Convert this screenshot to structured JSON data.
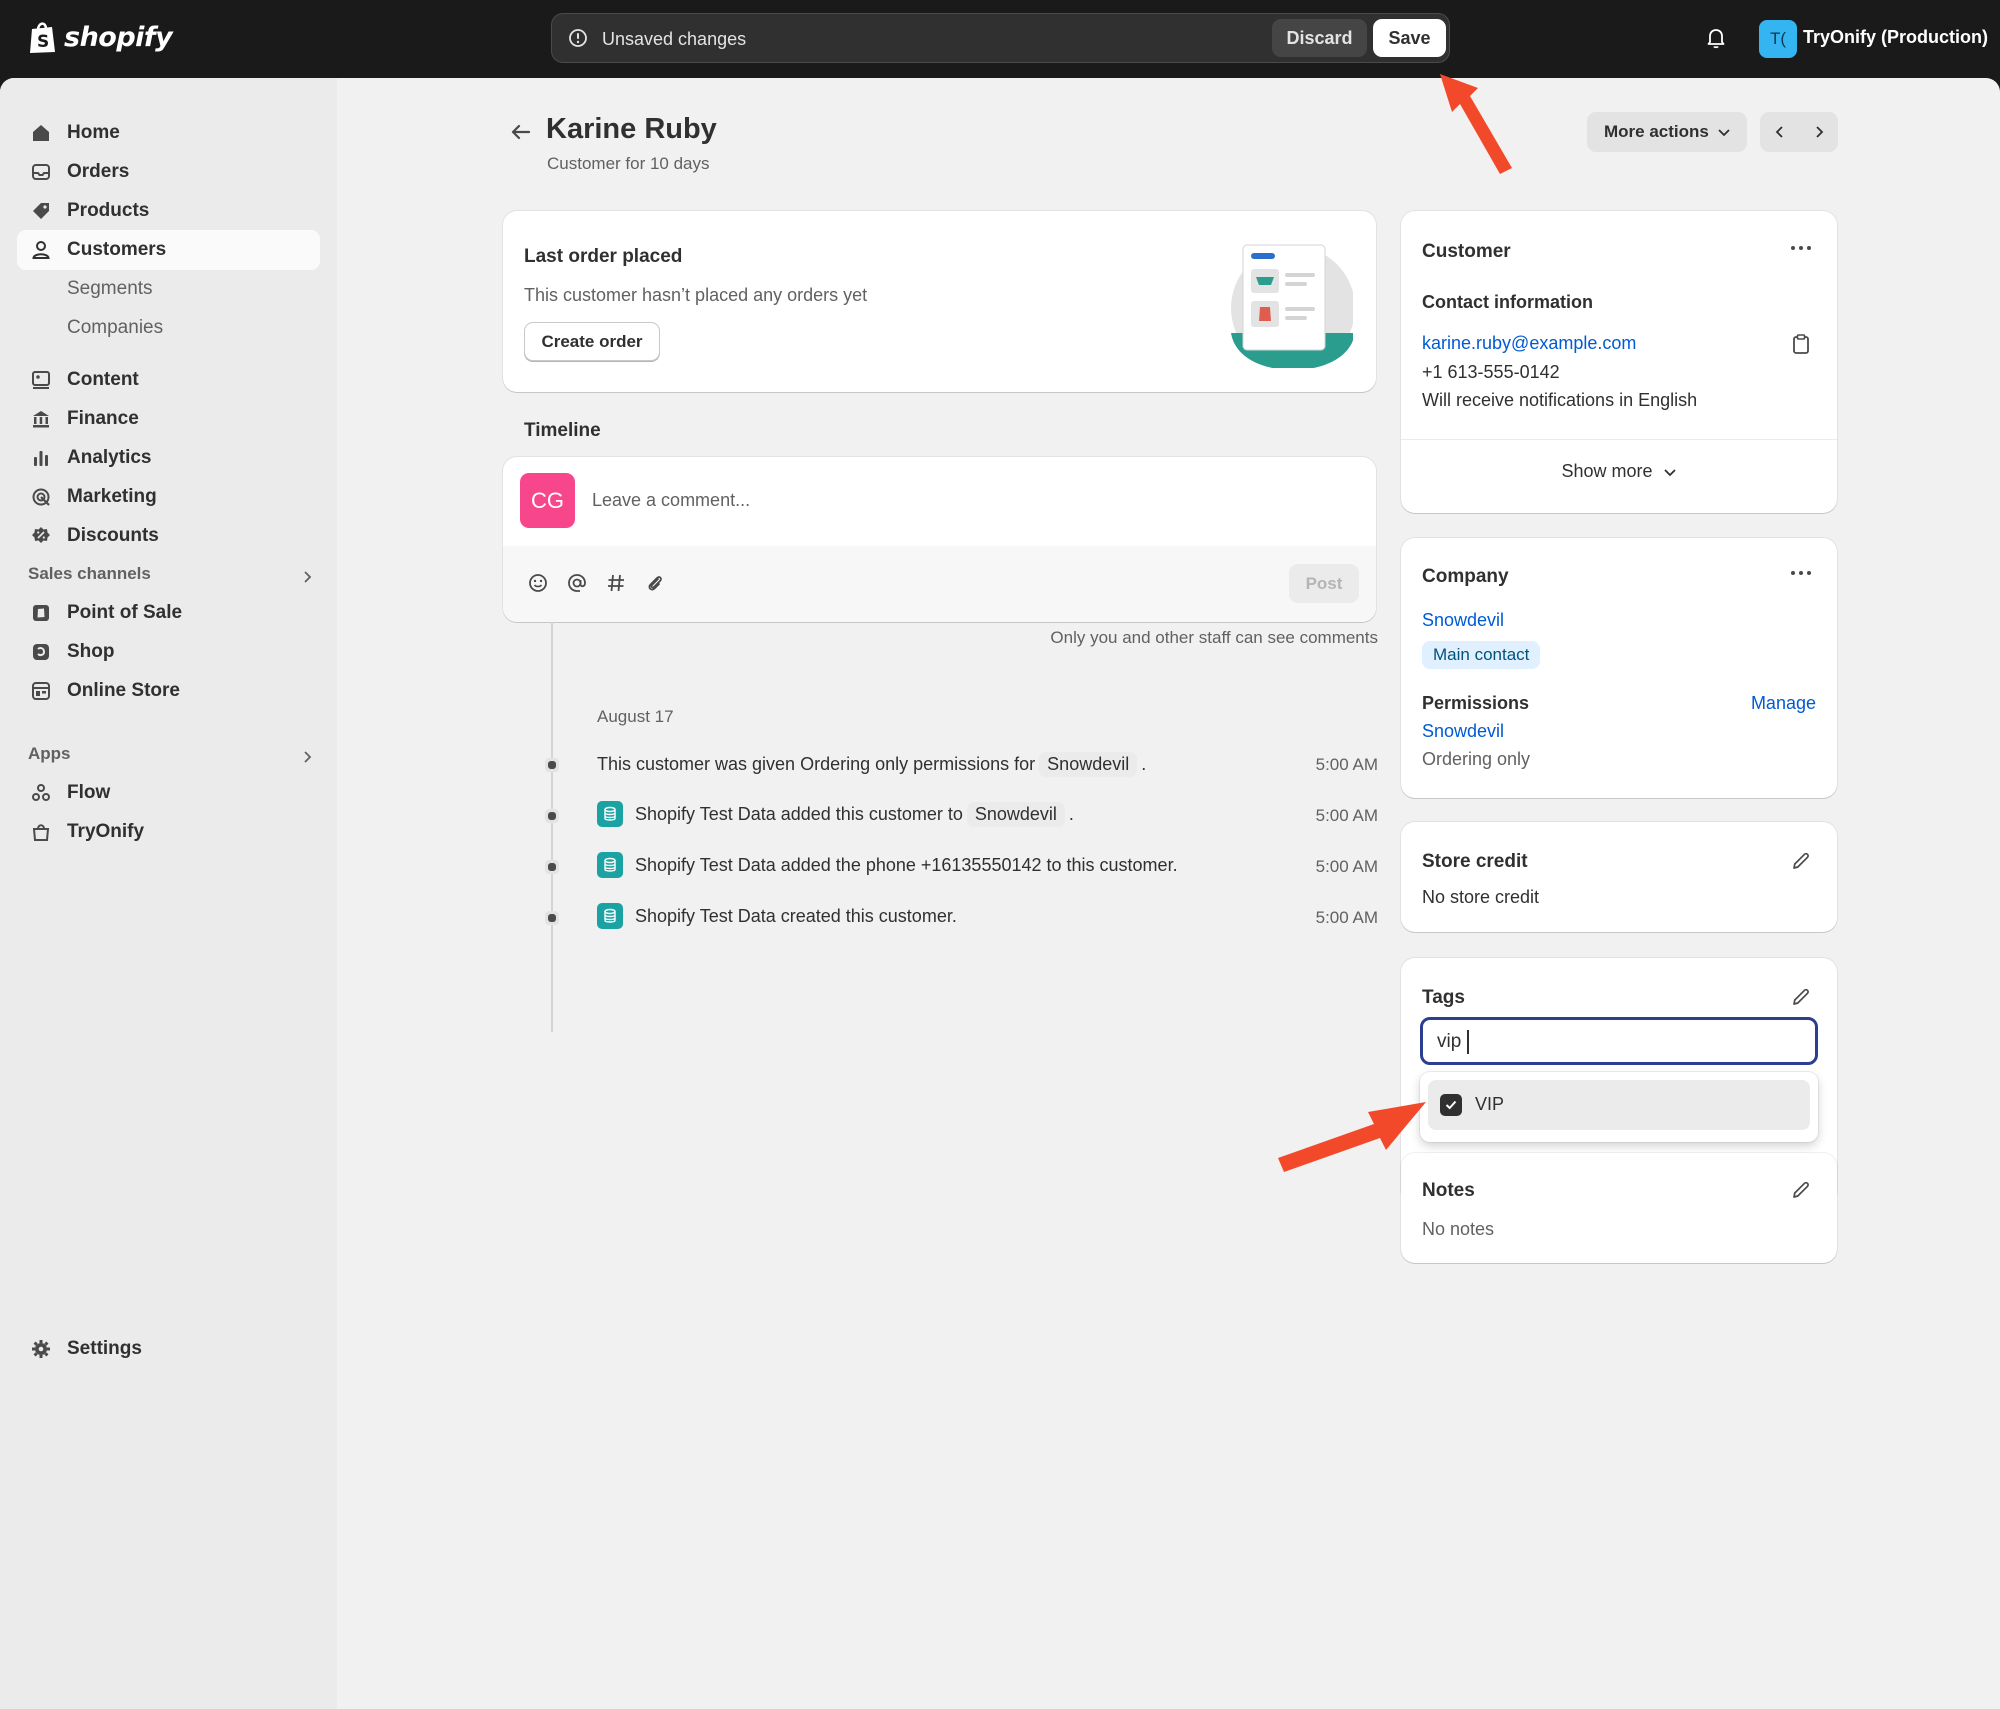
{
  "topbar": {
    "logo_text": "shopify",
    "unsaved_label": "Unsaved changes",
    "discard_label": "Discard",
    "save_label": "Save",
    "store_initials": "T(",
    "store_name": "TryOnify (Production)"
  },
  "sidebar": {
    "items": [
      {
        "label": "Home",
        "icon": "home-icon"
      },
      {
        "label": "Orders",
        "icon": "inbox-icon"
      },
      {
        "label": "Products",
        "icon": "tag-icon"
      },
      {
        "label": "Customers",
        "icon": "person-icon"
      },
      {
        "label": "Segments"
      },
      {
        "label": "Companies"
      },
      {
        "label": "Content",
        "icon": "content-icon"
      },
      {
        "label": "Finance",
        "icon": "bank-icon"
      },
      {
        "label": "Analytics",
        "icon": "bar-chart-icon"
      },
      {
        "label": "Marketing",
        "icon": "target-icon"
      },
      {
        "label": "Discounts",
        "icon": "discount-icon"
      }
    ],
    "sales_channels_label": "Sales channels",
    "channels": [
      {
        "label": "Point of Sale",
        "icon": "pos-icon"
      },
      {
        "label": "Shop",
        "icon": "shop-icon"
      },
      {
        "label": "Online Store",
        "icon": "store-icon"
      }
    ],
    "apps_label": "Apps",
    "apps": [
      {
        "label": "Flow",
        "icon": "flow-icon"
      },
      {
        "label": "TryOnify",
        "icon": "bag-icon"
      }
    ],
    "settings_label": "Settings"
  },
  "header": {
    "title": "Karine Ruby",
    "subtitle": "Customer for 10 days",
    "more_actions_label": "More actions"
  },
  "last_order": {
    "title": "Last order placed",
    "message": "This customer hasn’t placed any orders yet",
    "create_order_label": "Create order"
  },
  "timeline": {
    "title": "Timeline",
    "avatar_initials": "CG",
    "comment_placeholder": "Leave a comment...",
    "post_label": "Post",
    "staff_note": "Only you and other staff can see comments",
    "date_label": "August 17",
    "events": [
      {
        "pre": "This customer was given Ordering only permissions for",
        "pill": "Snowdevil",
        "post": ".",
        "time": "5:00 AM",
        "app": false
      },
      {
        "pre": "Shopify Test Data added this customer to",
        "pill": "Snowdevil",
        "post": ".",
        "time": "5:00 AM",
        "app": true
      },
      {
        "pre": "Shopify Test Data added the phone +16135550142 to this customer.",
        "pill": "",
        "post": "",
        "time": "5:00 AM",
        "app": true
      },
      {
        "pre": "Shopify Test Data created this customer.",
        "pill": "",
        "post": "",
        "time": "5:00 AM",
        "app": true
      }
    ]
  },
  "customer": {
    "title": "Customer",
    "contact_heading": "Contact information",
    "email": "karine.ruby@example.com",
    "phone": "+1 613-555-0142",
    "notifications": "Will receive notifications in English",
    "show_more_label": "Show more"
  },
  "company": {
    "title": "Company",
    "name": "Snowdevil",
    "badge": "Main contact",
    "permissions_heading": "Permissions",
    "manage_label": "Manage",
    "permissions_company": "Snowdevil",
    "permissions_value": "Ordering only"
  },
  "store_credit": {
    "title": "Store credit",
    "value": "No store credit"
  },
  "tags": {
    "title": "Tags",
    "input_value": "vip",
    "option_label": "VIP",
    "option_checked": true
  },
  "notes": {
    "title": "Notes",
    "value": "No notes"
  },
  "colors": {
    "accent_link": "#005bd3",
    "annotation_arrow": "#f2492a",
    "avatar_bg": "#f7468b",
    "app_icon": "#1ba3a3"
  }
}
